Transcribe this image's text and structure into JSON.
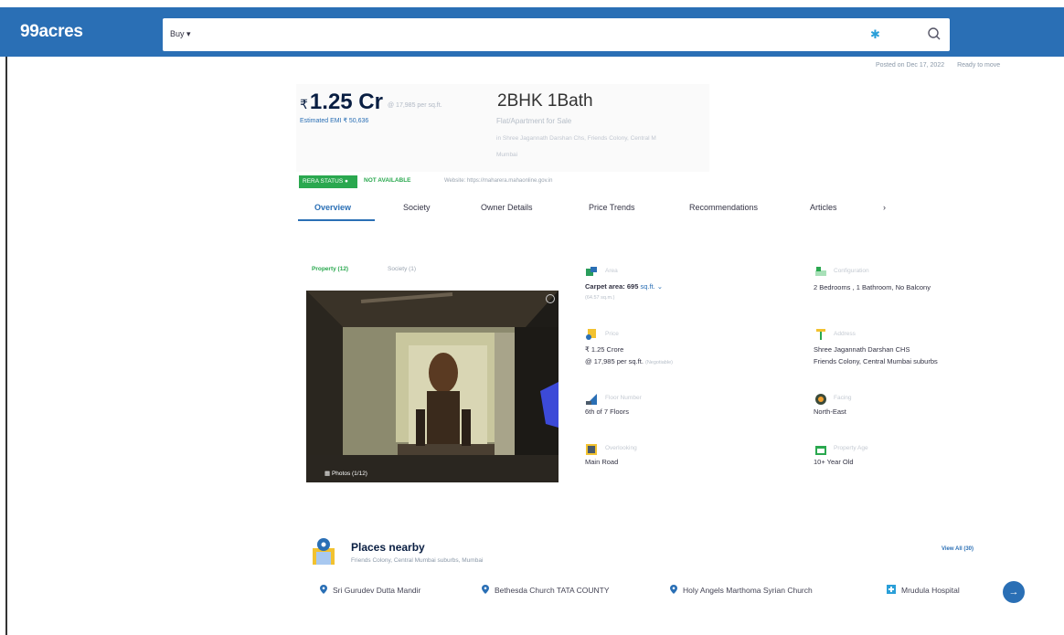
{
  "header": {
    "logo": "99acres",
    "search_mode": "Buy",
    "search_placeholder": ""
  },
  "posted": {
    "date": "Posted on Dec 17, 2022",
    "status": "Ready to move"
  },
  "price": {
    "rupee": "₹",
    "amount": "1.25 Cr",
    "per_sqft": "@ 17,985 per sq.ft.",
    "emi": "Estimated EMI ₹ 50,636"
  },
  "property": {
    "config": "2BHK 1Bath",
    "sub1": "Flat/Apartment for Sale",
    "sub2": "in Shree Jagannath Darshan Chs, Friends Colony, Central M",
    "sub3": "Mumbai"
  },
  "rera": {
    "badge": "RERA STATUS",
    "status": "NOT AVAILABLE",
    "website": "Website: https://maharera.mahaonline.gov.in"
  },
  "tabs": [
    {
      "label": "Overview"
    },
    {
      "label": "Society"
    },
    {
      "label": "Owner Details"
    },
    {
      "label": "Price Trends"
    },
    {
      "label": "Recommendations"
    },
    {
      "label": "Articles"
    },
    {
      "label": "›"
    }
  ],
  "gallery": {
    "tab_property": "Property (12)",
    "tab_society": "Society (1)",
    "photo_count": "Photos (1/12)"
  },
  "details": {
    "area": {
      "label": "Area",
      "value": "Carpet area: 695",
      "unit": "sq.ft. ⌄",
      "small": "(64.57 sq.m.)"
    },
    "config": {
      "label": "Configuration",
      "value": "2 Bedrooms , 1 Bathroom, No Balcony"
    },
    "price": {
      "label": "Price",
      "value": "₹ 1.25 Crore",
      "value2": "@ 17,985 per sq.ft.",
      "small": "(Negotiable)"
    },
    "address": {
      "label": "Address",
      "value": "Shree Jagannath Darshan CHS",
      "value2": "Friends Colony, Central Mumbai suburbs"
    },
    "floor": {
      "label": "Floor Number",
      "value": "6th  of 7 Floors"
    },
    "facing": {
      "label": "Facing",
      "value": "North-East"
    },
    "overlooking": {
      "label": "Overlooking",
      "value": "Main Road"
    },
    "age": {
      "label": "Property Age",
      "value": "10+ Year Old"
    }
  },
  "places": {
    "title": "Places nearby",
    "subtitle": "Friends Colony, Central Mumbai suburbs, Mumbai",
    "view_all": "View All (30)",
    "items": [
      {
        "label": "Sri Gurudev Dutta Mandir"
      },
      {
        "label": "Bethesda Church TATA COUNTY"
      },
      {
        "label": "Holy Angels Marthoma Syrian Church"
      },
      {
        "label": "Mrudula Hospital"
      }
    ],
    "next": "→"
  },
  "colors": {
    "brand": "#2a6fb5",
    "green": "#2aa84f"
  }
}
